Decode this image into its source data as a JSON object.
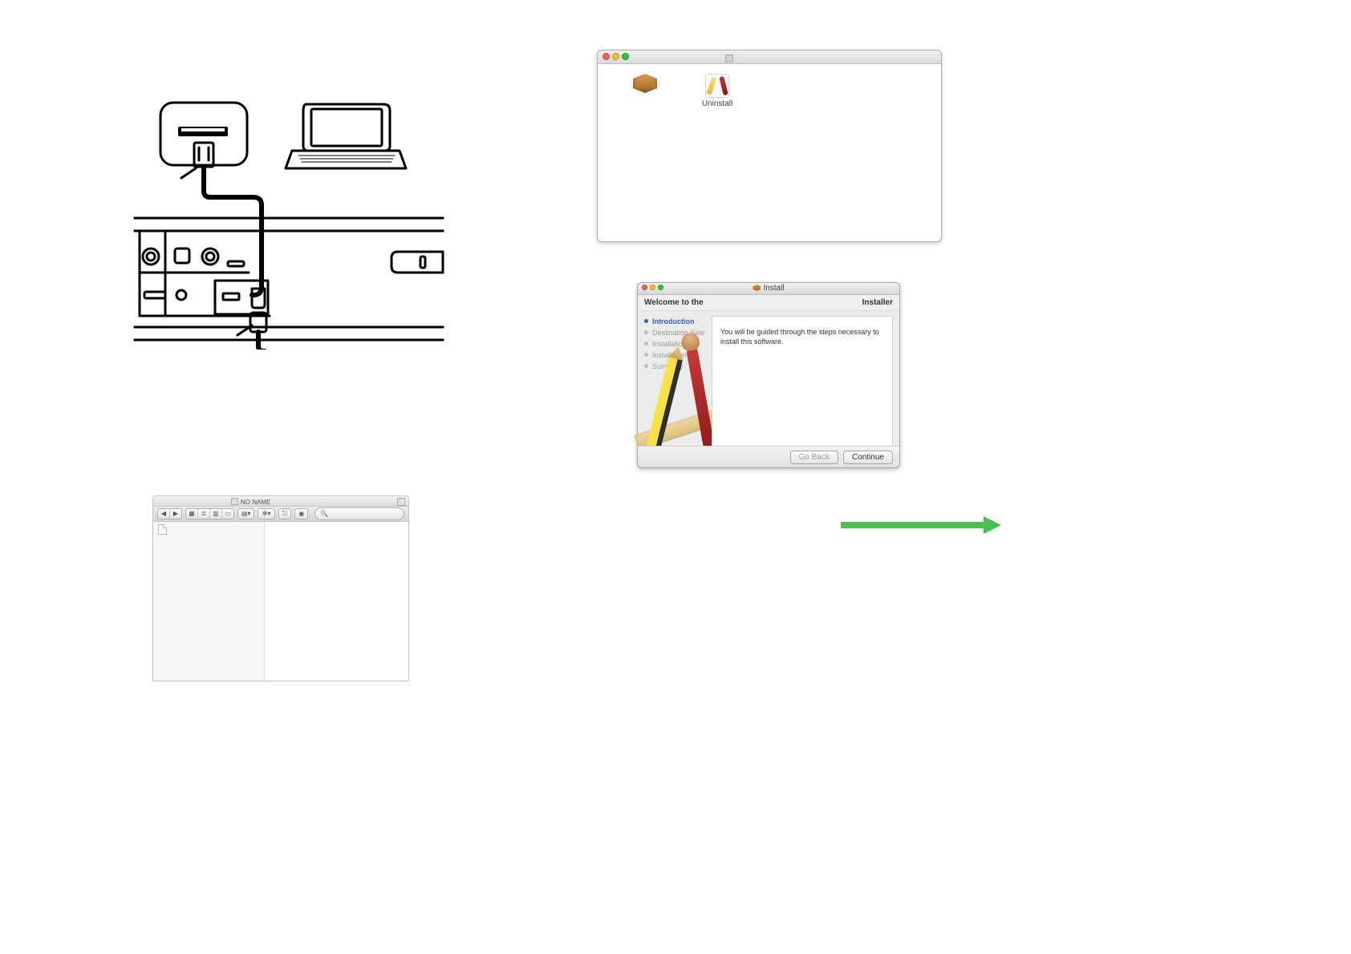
{
  "finder_top": {
    "items": [
      {
        "name": "package-icon",
        "label": ""
      },
      {
        "name": "uninstall-icon",
        "label": "Uninstall"
      }
    ]
  },
  "installer": {
    "window_title": "Install",
    "header_left": "Welcome to the",
    "header_right": "Installer",
    "steps": [
      "Introduction",
      "Destination Sele",
      "Installation",
      "Installation",
      "Summary"
    ],
    "active_step_index": 0,
    "body_text": "You will be guided through the steps necessary to install this software.",
    "buttons": {
      "back": "Go Back",
      "continue": "Continue"
    }
  },
  "finder_bottom": {
    "title": "NO NAME",
    "search_placeholder": "",
    "toolbar_icons": [
      "nav-back-forward",
      "view-icons",
      "view-list",
      "view-columns",
      "view-coverflow",
      "arrange",
      "action",
      "share",
      "tags",
      "search"
    ],
    "sidebar_items": [
      ""
    ]
  },
  "arrow": {
    "color": "#4dbf4d"
  }
}
